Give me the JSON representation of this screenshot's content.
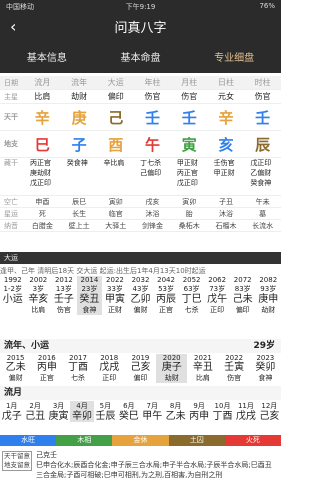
{
  "status": {
    "carrier": "中国移动",
    "time": "下午9:19",
    "battery": "76%"
  },
  "header": {
    "title": "问真八字",
    "back": "‹"
  },
  "tabs": [
    "基本信息",
    "基本命盘",
    "专业细盘"
  ],
  "pillars": {
    "labels": [
      "日期",
      "流月",
      "流年",
      "大运",
      "年柱",
      "月柱",
      "日柱",
      "时柱"
    ],
    "main_label": "主星",
    "gods": [
      "比肩",
      "劫财",
      "偏印",
      "伤官",
      "伤官",
      "元女",
      "伤官"
    ],
    "tg_label": "天干",
    "tg": [
      "辛",
      "庚",
      "己",
      "壬",
      "壬",
      "辛",
      "壬"
    ],
    "dz_label": "地支",
    "dz": [
      "巳",
      "子",
      "酉",
      "午",
      "寅",
      "亥",
      "辰"
    ],
    "hidden_label": "藏干",
    "hidden": [
      [
        "丙正官",
        "庚劫财",
        "戊正印"
      ],
      [
        "癸食神"
      ],
      [
        "辛比肩"
      ],
      [
        "丁七杀",
        "己偏印"
      ],
      [
        "甲正财",
        "丙正官",
        "戊正印"
      ],
      [
        "壬伤官",
        "甲正财"
      ],
      [
        "戊正印",
        "乙偏财",
        "癸食神"
      ]
    ],
    "kongwang_label": "空亡",
    "kongwang": [
      "申酉",
      "辰巳",
      "寅卯",
      "戌亥",
      "寅卯",
      "子丑",
      "午未"
    ],
    "xingyun_label": "星运",
    "xingyun": [
      "死",
      "长生",
      "临官",
      "沐浴",
      "胎",
      "沐浴",
      "墓"
    ],
    "nayin_label": "纳音",
    "nayin": [
      "白腊金",
      "壁上土",
      "大驿土",
      "剑锋金",
      "桑柘木",
      "石榴木",
      "长流水"
    ]
  },
  "banner": "大运",
  "luck": {
    "line": "逢甲、己年 清明后18天 交大运 起运:出生后1年4月13天10时起运",
    "years": [
      "1992",
      "2002",
      "2012",
      "2014",
      "2022",
      "2032",
      "2042",
      "2052",
      "2062",
      "2072",
      "2082"
    ],
    "ages": [
      "1-2岁",
      "3岁",
      "13岁",
      "23岁",
      "33岁",
      "43岁",
      "53岁",
      "63岁",
      "73岁",
      "83岁",
      "93岁"
    ],
    "row1": [
      "小运",
      "辛亥",
      "壬子",
      "癸丑",
      "甲寅",
      "乙卯",
      "丙辰",
      "丁巳",
      "戊午",
      "己未",
      "庚申"
    ],
    "row2": [
      "",
      "比肩",
      "伤官",
      "食神",
      "正财",
      "偏财",
      "正官",
      "七杀",
      "正印",
      "偏印",
      "劫财"
    ],
    "liunian_label": "流年、小运",
    "age_right": "29岁",
    "ln_years": [
      "2015",
      "2016",
      "2017",
      "2018",
      "2019",
      "2020",
      "2021",
      "2022",
      "2023"
    ],
    "ln1": [
      "乙未",
      "丙申",
      "丁酉",
      "戊戌",
      "己亥",
      "庚子",
      "辛丑",
      "壬寅",
      "癸卯"
    ],
    "ln2": [
      "偏财",
      "正官",
      "七杀",
      "正印",
      "偏印",
      "劫财",
      "比肩",
      "伤官",
      "食神"
    ]
  },
  "liuyue": {
    "label": "流月",
    "months": [
      "1月",
      "2月",
      "3月",
      "4月",
      "5月",
      "6月",
      "7月",
      "8月",
      "9月",
      "10月",
      "11月",
      "12月"
    ],
    "gz": [
      "戊子",
      "己丑",
      "庚寅",
      "辛卯",
      "壬辰",
      "癸巳",
      "甲午",
      "乙未",
      "丙申",
      "丁酉",
      "戊戌",
      "己亥"
    ]
  },
  "five": [
    {
      "name": "水旺",
      "color": "#2f80ed"
    },
    {
      "name": "木相",
      "color": "#43a047"
    },
    {
      "name": "金休",
      "color": "#e6a23c"
    },
    {
      "name": "土囚",
      "color": "#8a6b2d"
    },
    {
      "name": "火死",
      "color": "#e53935"
    }
  ],
  "info": {
    "side": "天干留意 地支留意",
    "line1": "己克壬",
    "line2": "巳申合化水;辰酉合化金;申子辰三合水局;申子半合水局;子辰半合水局;巳酉丑三合金局;子酉可相破;巳申可相刑,为之刑,百相害,为自刑之刑"
  }
}
